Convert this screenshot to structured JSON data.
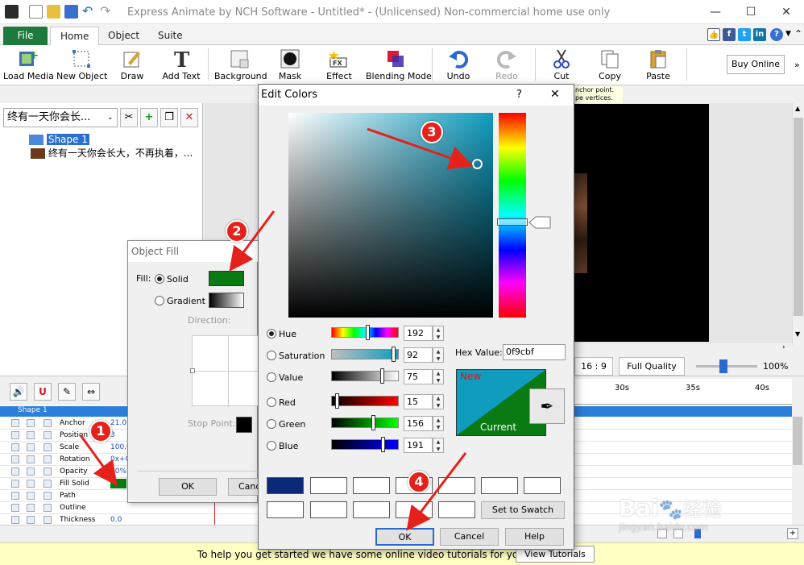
{
  "window": {
    "title": "Express Animate by NCH Software - Untitled* - (Unlicensed) Non-commercial home use only",
    "controls": [
      "—",
      "☐",
      "✕"
    ]
  },
  "ribbon": {
    "file_tab": "File",
    "tabs": [
      "Home",
      "Object",
      "Suite"
    ],
    "social": [
      "f",
      "t",
      "in"
    ],
    "help": "?"
  },
  "toolbar": {
    "load_media": "Load Media",
    "new_object": "New Object",
    "draw": "Draw",
    "add_text": "Add Text",
    "background": "Background",
    "mask": "Mask",
    "effect": "Effect",
    "blending_mode": "Blending Mode",
    "undo": "Undo",
    "redo": "Redo",
    "cut": "Cut",
    "copy": "Copy",
    "paste": "Paste",
    "buy_online": "Buy Online"
  },
  "tooltip": {
    "line1": "nchor point.",
    "line2": "pe vertices."
  },
  "left_panel": {
    "combo_value": "终有一天你会长...",
    "tree": {
      "shape": "Shape 1",
      "text": "终有一天你会长大，不再执着，..."
    }
  },
  "preview": {
    "aspect": "16 : 9",
    "quality": "Full Quality",
    "zoom": "100%",
    "zoom_fraction": 0.45
  },
  "timeline": {
    "ruler": [
      "30s",
      "35s",
      "40s"
    ],
    "track_header": "Shape 1",
    "rows": [
      {
        "label": "Anchor",
        "value": "21.0"
      },
      {
        "label": "Position",
        "value": "3"
      },
      {
        "label": "Scale",
        "value": "100.0"
      },
      {
        "label": "Rotation",
        "value": "0x+0"
      },
      {
        "label": "Opacity",
        "value": "00%"
      },
      {
        "label": "Fill Solid",
        "value": ""
      },
      {
        "label": "Path",
        "value": ""
      },
      {
        "label": "Outline",
        "value": ""
      },
      {
        "label": "Thickness",
        "value": "0.0"
      }
    ]
  },
  "notify": {
    "message": "To help you get started we have some online video tutorials for you",
    "button": "View Tutorials"
  },
  "object_fill": {
    "title": "Object Fill",
    "fill_label": "Fill:",
    "solid": "Solid",
    "gradient": "Gradient",
    "direction": "Direction:",
    "stop_point": "Stop Point:",
    "ok": "OK",
    "cancel": "Canc",
    "fill_color": "#0a7a12"
  },
  "edit_colors": {
    "title": "Edit Colors",
    "help": "?",
    "close": "✕",
    "hue": {
      "label": "Hue",
      "value": "192"
    },
    "saturation": {
      "label": "Saturation",
      "value": "92"
    },
    "value": {
      "label": "Value",
      "value": "75"
    },
    "red": {
      "label": "Red",
      "value": "15"
    },
    "green": {
      "label": "Green",
      "value": "156"
    },
    "blue": {
      "label": "Blue",
      "value": "191"
    },
    "hex_label": "Hex Value:",
    "hex_value": "0f9cbf",
    "new_label": "New",
    "current_label": "Current",
    "new_color": "#0f9cbf",
    "current_color": "#0a7a12",
    "set_to_swatch": "Set to Swatch",
    "ok": "OK",
    "cancel": "Cancel",
    "help_button": "Help",
    "first_swatch": "#0a2a78"
  },
  "annotations": [
    "1",
    "2",
    "3",
    "4"
  ],
  "watermark": {
    "brand": "Bai",
    "cn": "经验",
    "url": "jingyan.baidu.com"
  }
}
